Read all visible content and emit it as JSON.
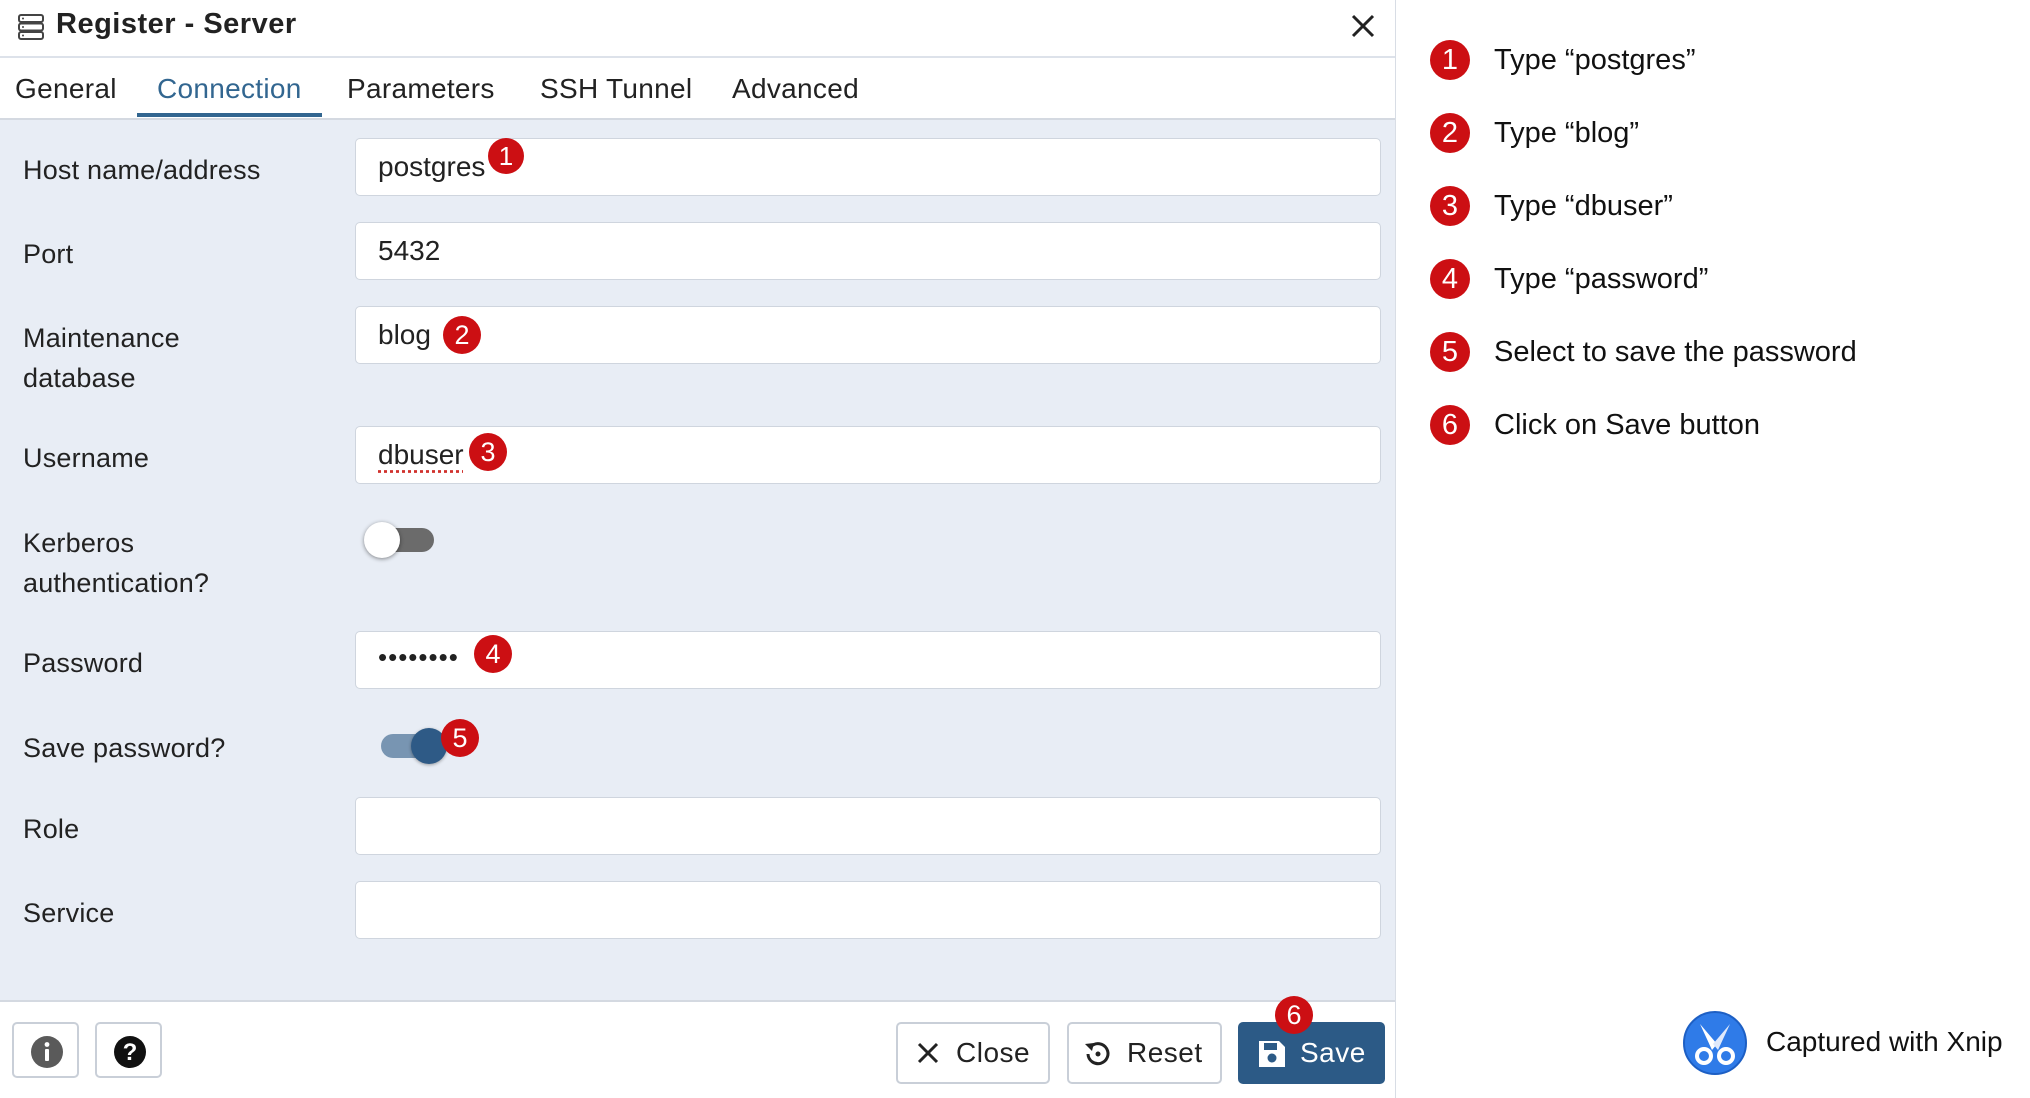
{
  "dialog": {
    "title": "Register - Server",
    "tabs": [
      "General",
      "Connection",
      "Parameters",
      "SSH Tunnel",
      "Advanced"
    ],
    "active_tab": "Connection"
  },
  "form": {
    "host_label": "Host name/address",
    "host_value": "postgres",
    "port_label": "Port",
    "port_value": "5432",
    "maint_label_line1": "Maintenance",
    "maint_label_line2": "database",
    "maint_value": "blog",
    "username_label": "Username",
    "username_value": "dbuser",
    "kerberos_label_line1": "Kerberos",
    "kerberos_label_line2": "authentication?",
    "kerberos_enabled": false,
    "password_label": "Password",
    "password_value": "••••••••",
    "save_password_label": "Save password?",
    "save_password_enabled": true,
    "role_label": "Role",
    "role_value": "",
    "service_label": "Service",
    "service_value": ""
  },
  "footer": {
    "info_icon": "info-icon",
    "help_icon": "question-icon",
    "close_label": "Close",
    "reset_label": "Reset",
    "save_label": "Save"
  },
  "markers": [
    "1",
    "2",
    "3",
    "4",
    "5",
    "6"
  ],
  "steps": [
    {
      "num": "1",
      "text": "Type “postgres”"
    },
    {
      "num": "2",
      "text": "Type “blog”"
    },
    {
      "num": "3",
      "text": "Type “dbuser”"
    },
    {
      "num": "4",
      "text": "Type “password”"
    },
    {
      "num": "5",
      "text": "Select to save the password"
    },
    {
      "num": "6",
      "text": "Click on Save button"
    }
  ],
  "watermark": {
    "text": "Captured with Xnip"
  },
  "colors": {
    "accent": "#326690",
    "primary_button": "#2c5a86",
    "marker_red": "#cc0f13",
    "dialog_bg": "#e8edf5"
  }
}
